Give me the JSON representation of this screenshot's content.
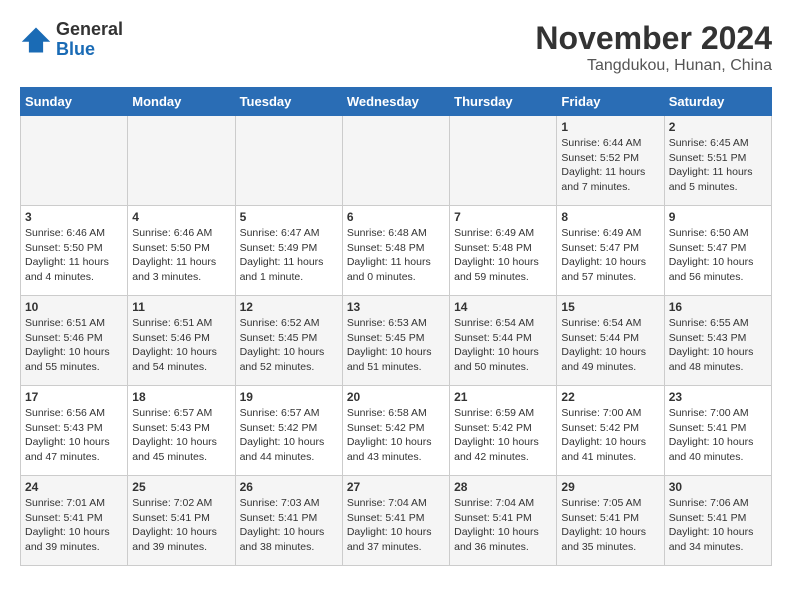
{
  "header": {
    "logo_general": "General",
    "logo_blue": "Blue",
    "month_title": "November 2024",
    "location": "Tangdukou, Hunan, China"
  },
  "days_of_week": [
    "Sunday",
    "Monday",
    "Tuesday",
    "Wednesday",
    "Thursday",
    "Friday",
    "Saturday"
  ],
  "weeks": [
    [
      {
        "day": "",
        "info": ""
      },
      {
        "day": "",
        "info": ""
      },
      {
        "day": "",
        "info": ""
      },
      {
        "day": "",
        "info": ""
      },
      {
        "day": "",
        "info": ""
      },
      {
        "day": "1",
        "info": "Sunrise: 6:44 AM\nSunset: 5:52 PM\nDaylight: 11 hours and 7 minutes."
      },
      {
        "day": "2",
        "info": "Sunrise: 6:45 AM\nSunset: 5:51 PM\nDaylight: 11 hours and 5 minutes."
      }
    ],
    [
      {
        "day": "3",
        "info": "Sunrise: 6:46 AM\nSunset: 5:50 PM\nDaylight: 11 hours and 4 minutes."
      },
      {
        "day": "4",
        "info": "Sunrise: 6:46 AM\nSunset: 5:50 PM\nDaylight: 11 hours and 3 minutes."
      },
      {
        "day": "5",
        "info": "Sunrise: 6:47 AM\nSunset: 5:49 PM\nDaylight: 11 hours and 1 minute."
      },
      {
        "day": "6",
        "info": "Sunrise: 6:48 AM\nSunset: 5:48 PM\nDaylight: 11 hours and 0 minutes."
      },
      {
        "day": "7",
        "info": "Sunrise: 6:49 AM\nSunset: 5:48 PM\nDaylight: 10 hours and 59 minutes."
      },
      {
        "day": "8",
        "info": "Sunrise: 6:49 AM\nSunset: 5:47 PM\nDaylight: 10 hours and 57 minutes."
      },
      {
        "day": "9",
        "info": "Sunrise: 6:50 AM\nSunset: 5:47 PM\nDaylight: 10 hours and 56 minutes."
      }
    ],
    [
      {
        "day": "10",
        "info": "Sunrise: 6:51 AM\nSunset: 5:46 PM\nDaylight: 10 hours and 55 minutes."
      },
      {
        "day": "11",
        "info": "Sunrise: 6:51 AM\nSunset: 5:46 PM\nDaylight: 10 hours and 54 minutes."
      },
      {
        "day": "12",
        "info": "Sunrise: 6:52 AM\nSunset: 5:45 PM\nDaylight: 10 hours and 52 minutes."
      },
      {
        "day": "13",
        "info": "Sunrise: 6:53 AM\nSunset: 5:45 PM\nDaylight: 10 hours and 51 minutes."
      },
      {
        "day": "14",
        "info": "Sunrise: 6:54 AM\nSunset: 5:44 PM\nDaylight: 10 hours and 50 minutes."
      },
      {
        "day": "15",
        "info": "Sunrise: 6:54 AM\nSunset: 5:44 PM\nDaylight: 10 hours and 49 minutes."
      },
      {
        "day": "16",
        "info": "Sunrise: 6:55 AM\nSunset: 5:43 PM\nDaylight: 10 hours and 48 minutes."
      }
    ],
    [
      {
        "day": "17",
        "info": "Sunrise: 6:56 AM\nSunset: 5:43 PM\nDaylight: 10 hours and 47 minutes."
      },
      {
        "day": "18",
        "info": "Sunrise: 6:57 AM\nSunset: 5:43 PM\nDaylight: 10 hours and 45 minutes."
      },
      {
        "day": "19",
        "info": "Sunrise: 6:57 AM\nSunset: 5:42 PM\nDaylight: 10 hours and 44 minutes."
      },
      {
        "day": "20",
        "info": "Sunrise: 6:58 AM\nSunset: 5:42 PM\nDaylight: 10 hours and 43 minutes."
      },
      {
        "day": "21",
        "info": "Sunrise: 6:59 AM\nSunset: 5:42 PM\nDaylight: 10 hours and 42 minutes."
      },
      {
        "day": "22",
        "info": "Sunrise: 7:00 AM\nSunset: 5:42 PM\nDaylight: 10 hours and 41 minutes."
      },
      {
        "day": "23",
        "info": "Sunrise: 7:00 AM\nSunset: 5:41 PM\nDaylight: 10 hours and 40 minutes."
      }
    ],
    [
      {
        "day": "24",
        "info": "Sunrise: 7:01 AM\nSunset: 5:41 PM\nDaylight: 10 hours and 39 minutes."
      },
      {
        "day": "25",
        "info": "Sunrise: 7:02 AM\nSunset: 5:41 PM\nDaylight: 10 hours and 39 minutes."
      },
      {
        "day": "26",
        "info": "Sunrise: 7:03 AM\nSunset: 5:41 PM\nDaylight: 10 hours and 38 minutes."
      },
      {
        "day": "27",
        "info": "Sunrise: 7:04 AM\nSunset: 5:41 PM\nDaylight: 10 hours and 37 minutes."
      },
      {
        "day": "28",
        "info": "Sunrise: 7:04 AM\nSunset: 5:41 PM\nDaylight: 10 hours and 36 minutes."
      },
      {
        "day": "29",
        "info": "Sunrise: 7:05 AM\nSunset: 5:41 PM\nDaylight: 10 hours and 35 minutes."
      },
      {
        "day": "30",
        "info": "Sunrise: 7:06 AM\nSunset: 5:41 PM\nDaylight: 10 hours and 34 minutes."
      }
    ]
  ]
}
